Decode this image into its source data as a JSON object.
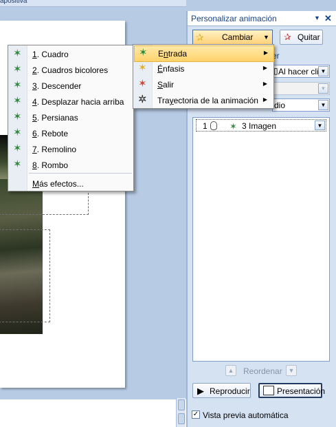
{
  "window": {
    "fragment_title": "apositiva"
  },
  "task_pane": {
    "title": "Personalizar animación",
    "change_button": "Cambiar",
    "remove_button": "Quitar",
    "partial_label": "er",
    "start_value": "Al hacer clic",
    "speed_value": "dio",
    "list": [
      {
        "order": "1",
        "label": "3 Imagen"
      }
    ],
    "reorder_label": "Reordenar",
    "play_button": "Reproducir",
    "slideshow_button": "Presentación",
    "preview_checkbox_label": "Vista previa automática",
    "preview_checked": true
  },
  "effect_types_menu": [
    {
      "label": "Entrada",
      "accel": "n",
      "pre": "E",
      "post": "trada",
      "color": "#2d8a3a",
      "highlighted": true
    },
    {
      "label": "Énfasis",
      "accel": "É",
      "pre": "",
      "post": "nfasis",
      "color": "#e0b020",
      "highlighted": false
    },
    {
      "label": "Salir",
      "accel": "S",
      "pre": "",
      "post": "alir",
      "color": "#d84030",
      "highlighted": false
    },
    {
      "label": "Trayectoria de la animación",
      "accel": "y",
      "pre": "Tra",
      "post": "ectoria de la animación",
      "color": "#ffffff",
      "highlighted": false
    }
  ],
  "effects_menu": [
    {
      "num": "1",
      "label": "Cuadro"
    },
    {
      "num": "2",
      "label": "Cuadros bicolores"
    },
    {
      "num": "3",
      "label": "Descender"
    },
    {
      "num": "4",
      "label": "Desplazar hacia arriba"
    },
    {
      "num": "5",
      "label": "Persianas"
    },
    {
      "num": "6",
      "label": "Rebote"
    },
    {
      "num": "7",
      "label": "Remolino"
    },
    {
      "num": "8",
      "label": "Rombo"
    }
  ],
  "more_effects": {
    "accel": "M",
    "rest": "ás efectos..."
  },
  "colors": {
    "accent_orange": "#ffd26c",
    "pane_blue": "#d5e2f2",
    "title_blue": "#15428b",
    "star_green": "#2d8a3a"
  }
}
